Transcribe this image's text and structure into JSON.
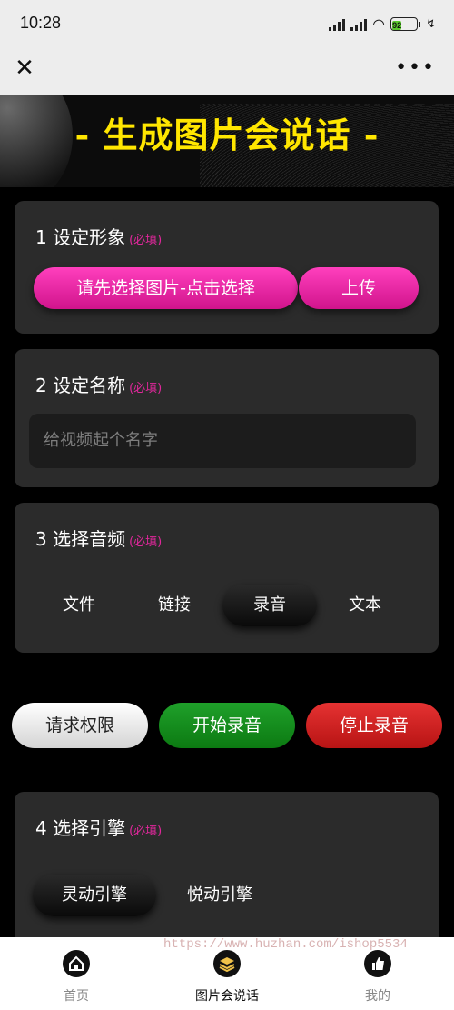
{
  "status_bar": {
    "time": "10:28",
    "battery": "92"
  },
  "banner": {
    "title": "- 生成图片会说话 -"
  },
  "required_label": "(必填)",
  "section1": {
    "title": "1 设定形象",
    "select_button": "请先选择图片-点击选择",
    "upload_button": "上传"
  },
  "section2": {
    "title": "2 设定名称",
    "name_placeholder": "给视频起个名字"
  },
  "section3": {
    "title": "3 选择音频",
    "tabs": [
      "文件",
      "链接",
      "录音",
      "文本"
    ],
    "active_tab": "录音"
  },
  "recording": {
    "permission_button": "请求权限",
    "start_button": "开始录音",
    "stop_button": "停止录音"
  },
  "section4": {
    "title": "4 选择引擎",
    "engines": [
      "灵动引擎",
      "悦动引擎"
    ],
    "active_engine": "灵动引擎"
  },
  "watermark": "https://www.huzhan.com/ishop5534",
  "tabbar": {
    "items": [
      "首页",
      "图片会说话",
      "我的"
    ],
    "active": "图片会说话"
  },
  "colors": {
    "accent_pink": "#e0279b",
    "title_yellow": "#ffe600",
    "start_green": "#1fa02a",
    "stop_red": "#d42020"
  }
}
